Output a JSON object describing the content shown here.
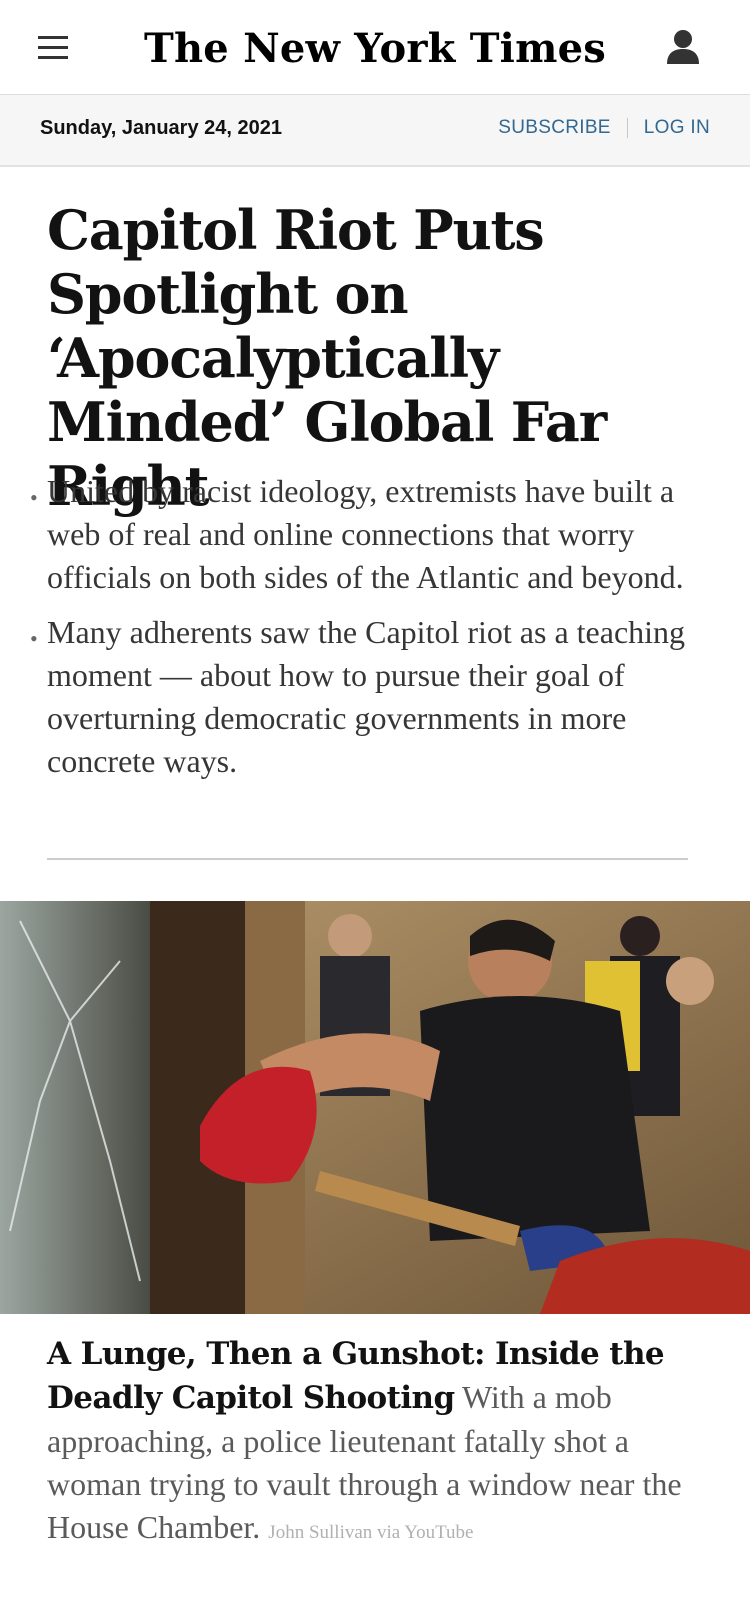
{
  "header": {
    "masthead": "The New York Times",
    "menu_icon": "hamburger-menu-icon",
    "account_icon": "user-account-icon"
  },
  "datebar": {
    "date": "Sunday, January 24, 2021",
    "subscribe_label": "SUBSCRIBE",
    "login_label": "LOG IN"
  },
  "lead_story": {
    "headline": "Capitol Riot Puts Spotlight on ‘Apocalyptically Minded’ Global Far Right",
    "summary": [
      "United by racist ideology, extremists have built a web of real and online connections that worry officials on both sides of the Atlantic and beyond.",
      "Many adherents saw the Capitol riot as a teaching moment — about how to pursue their goal of overturning democratic governments in more concrete ways."
    ]
  },
  "second_story": {
    "headline": "A Lunge, Then a Gunshot: Inside the Deadly Capitol Shooting",
    "summary": "With a mob approaching, a police lieutenant fatally shot a woman trying to vault through a window near the House Chamber.",
    "credit": "John Sullivan via YouTube"
  },
  "colors": {
    "link_blue": "#326891",
    "text_dark": "#121212",
    "datebar_bg": "#f6f6f6"
  }
}
